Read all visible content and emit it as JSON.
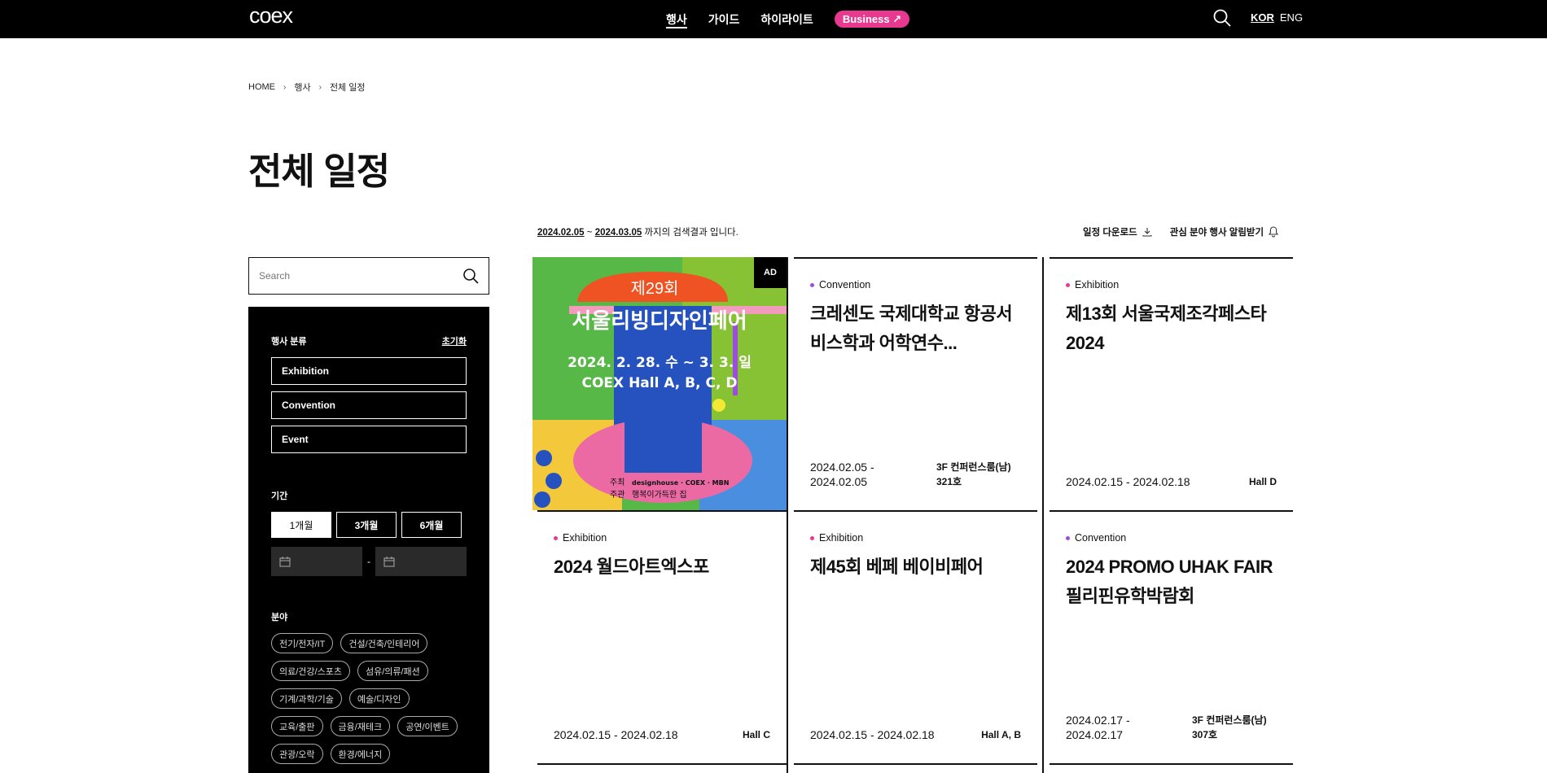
{
  "header": {
    "logo": "coex",
    "nav": [
      {
        "label": "행사",
        "active": true
      },
      {
        "label": "가이드",
        "active": false
      },
      {
        "label": "하이라이트",
        "active": false
      }
    ],
    "business_label": "Business ↗",
    "lang": {
      "kor": "KOR",
      "eng": "ENG"
    }
  },
  "breadcrumb": [
    "HOME",
    "행사",
    "전체 일정"
  ],
  "page_title": "전체 일정",
  "result": {
    "start": "2024.02.05",
    "tilde": "~",
    "end": "2024.03.05",
    "suffix": "까지의 검색결과 입니다."
  },
  "actions": {
    "download": "일정 다운로드",
    "alert": "관심 분야 행사 알림받기"
  },
  "search": {
    "placeholder": "Search"
  },
  "sidebar": {
    "category_label": "행사 분류",
    "reset": "초기화",
    "types": [
      "Exhibition",
      "Convention",
      "Event"
    ],
    "period_label": "기간",
    "periods": [
      "1개월",
      "3개월",
      "6개월"
    ],
    "date_sep": "-",
    "field_label": "분야",
    "tags": [
      "전기/전자/IT",
      "건설/건축/인테리어",
      "의료/건강/스포츠",
      "섬유/의류/패션",
      "기계/과학/기술",
      "예술/디자인",
      "교육/출판",
      "금융/재테크",
      "공연/이벤트",
      "관광/오락",
      "환경/에너지"
    ]
  },
  "ad": {
    "badge": "AD",
    "edition": "제29회",
    "name": "서울리빙디자인페어",
    "dates": "2024. 2. 28. 수 ~ 3. 3. 일",
    "venue": "COEX Hall A, B, C, D",
    "host_label": "주최",
    "host": "designhouse · COEX · MBN",
    "theme_label": "주관",
    "theme": "행복이가득한 집"
  },
  "cards": [
    {
      "category": "Convention",
      "color": "#9b4de0",
      "title": "크레센도 국제대학교 항공서비스학과 어학연수...",
      "date": "2024.02.05 -\n2024.02.05",
      "location": "3F 컨퍼런스룸(남)\n321호"
    },
    {
      "category": "Exhibition",
      "color": "#e8388f",
      "title": "제13회 서울국제조각페스타 2024",
      "date": "2024.02.15 - 2024.02.18",
      "location": "Hall D"
    },
    {
      "category": "Exhibition",
      "color": "#e8388f",
      "title": "2024 월드아트엑스포",
      "date": "2024.02.15 - 2024.02.18",
      "location": "Hall C"
    },
    {
      "category": "Exhibition",
      "color": "#e8388f",
      "title": "제45회 베페 베이비페어",
      "date": "2024.02.15 - 2024.02.18",
      "location": "Hall A, B"
    },
    {
      "category": "Convention",
      "color": "#9b4de0",
      "title": "2024 PROMO UHAK FAIR 필리핀유학박람회",
      "date": "2024.02.17 -\n2024.02.17",
      "location": "3F 컨퍼런스룸(남)\n307호"
    }
  ]
}
